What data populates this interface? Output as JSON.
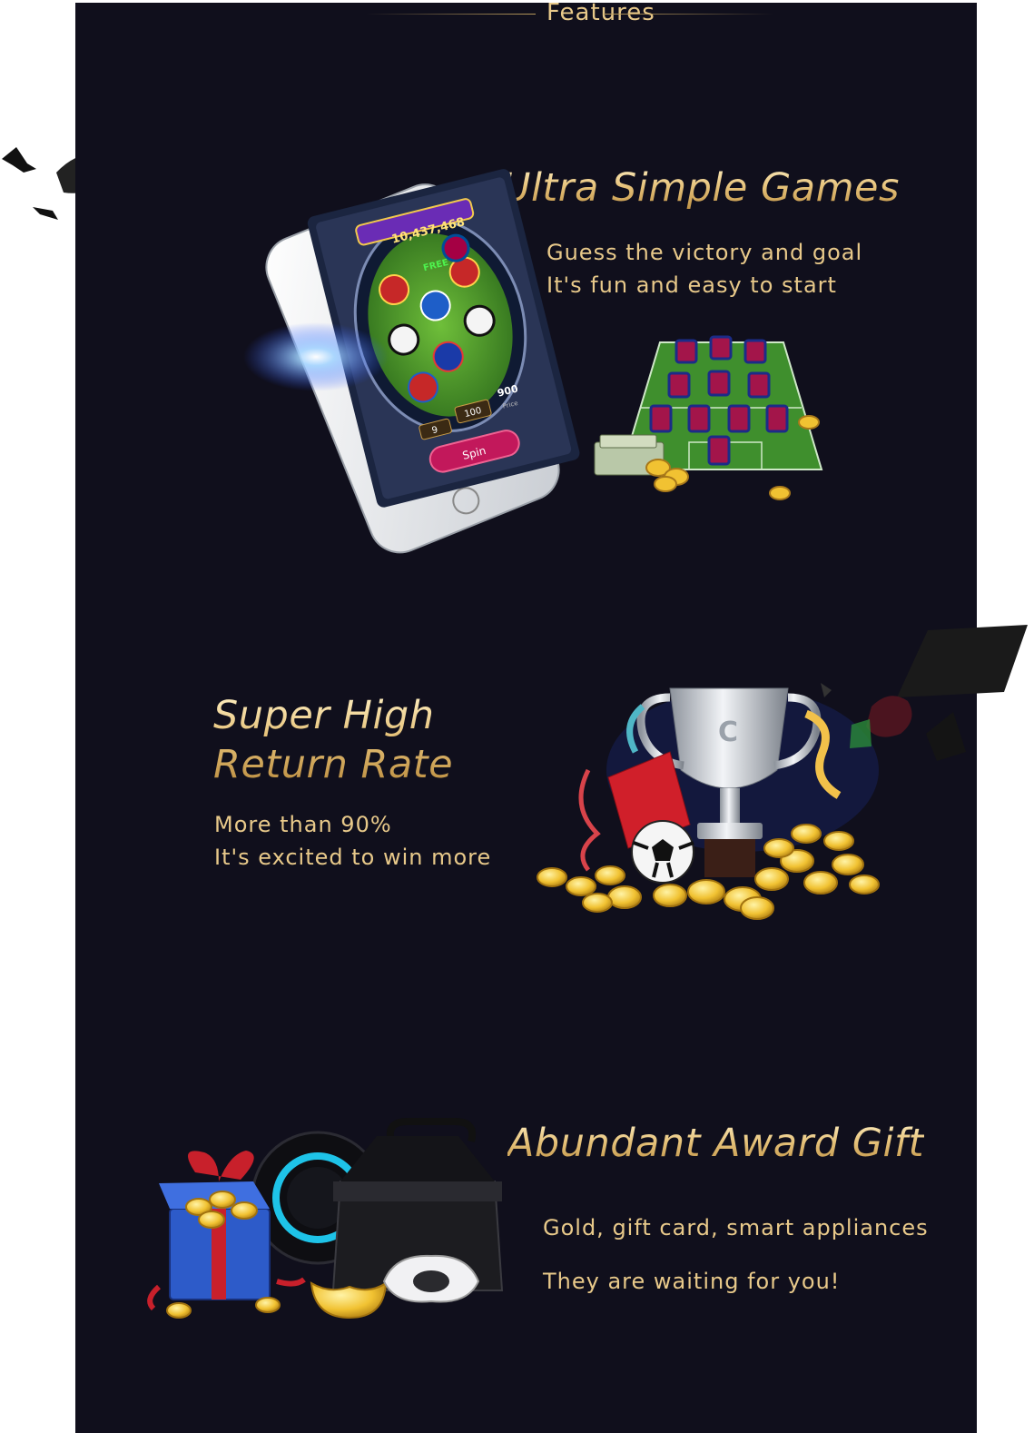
{
  "section_title": "Features",
  "features": [
    {
      "title": "Ultra Simple Games",
      "lines": [
        "Guess the victory and goal",
        "It's fun and easy to start"
      ],
      "illustration_icon": "phone-slot-game-icon",
      "secondary_icon": "football-field-jerseys-icon"
    },
    {
      "title_lines": [
        "Super High",
        "Return Rate"
      ],
      "lines": [
        "More than 90%",
        "It's excited to win more"
      ],
      "illustration_icon": "trophy-coins-icon"
    },
    {
      "title": "Abundant Award Gift",
      "lines": [
        "Gold, gift card, smart appliances",
        "They are waiting for you!"
      ],
      "illustration_icon": "gift-box-appliances-icon"
    }
  ],
  "game_screen": {
    "jackpot": "10,437,468",
    "free_label": "FREE",
    "bet_value": "100",
    "price_value": "900",
    "price_label": "Price",
    "lines_value": "9",
    "spin_label": "Spin"
  },
  "trophy_badge": "C",
  "colors": {
    "background": "#100f1c",
    "gold_light": "#fff1c6",
    "gold_dark": "#b98a3c",
    "body_text": "#e8c98a"
  }
}
